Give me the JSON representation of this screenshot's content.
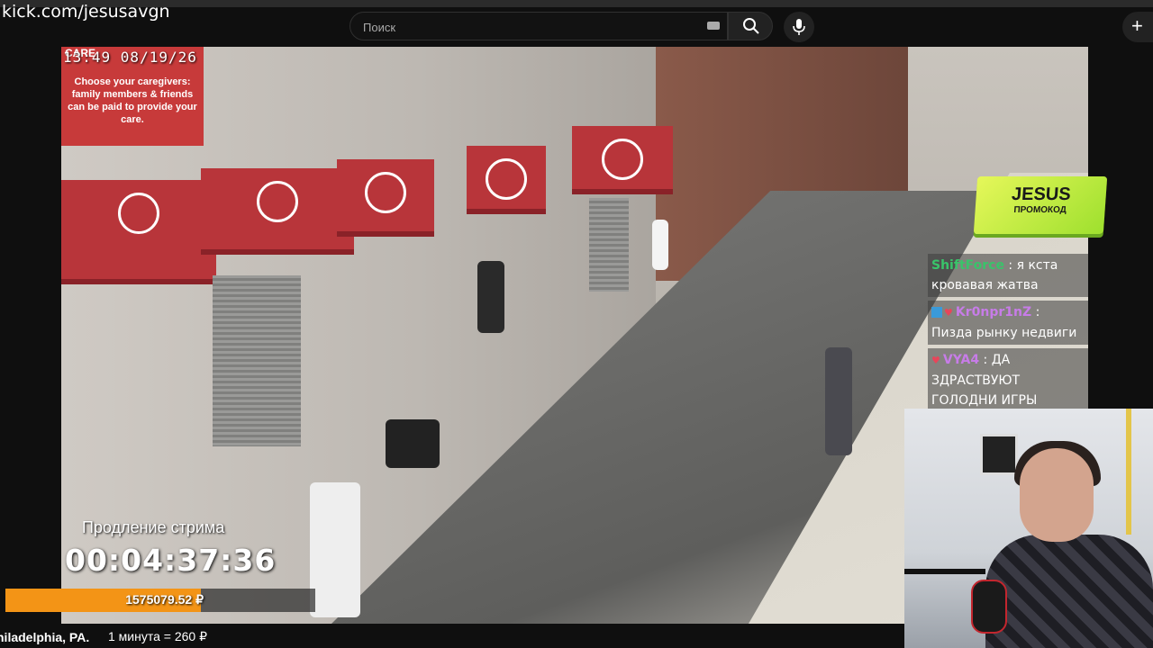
{
  "browser": {
    "url": "kick.com/jesusavgn"
  },
  "search": {
    "placeholder": "Поиск"
  },
  "icons": {
    "keyboard": "keyboard-icon",
    "search": "search-icon",
    "mic": "microphone-icon",
    "create": "plus-icon"
  },
  "create_label": "+",
  "video": {
    "cam_timestamp": "13:49 08/19/26",
    "sign_title": "CARE",
    "sign_text": "Choose your caregivers: family members & friends can be paid to provide your care."
  },
  "promo": {
    "title": "JESUS",
    "subtitle": "ПРОМОКОД"
  },
  "chat": {
    "messages": [
      {
        "user": "ShiftForce",
        "user_color": "#39c46a",
        "text": " : я кста кровавая жатва"
      },
      {
        "user": "Kr0npr1nZ",
        "user_color": "#c77ce8",
        "text": " : Пизда рынку недвиги"
      },
      {
        "user": "VYA4",
        "user_color": "#c77ce8",
        "text": " : ДА ЗДРАСТВУЮТ ГОЛОДНИ ИГРЫ"
      }
    ]
  },
  "stream": {
    "extension_label": "Продление стрима",
    "timer": "00:04:37:36",
    "amount": "1575079.52 ₽",
    "progress_fraction": 0.63,
    "rate": "1 минута = 260 ₽",
    "location": "hiladelphia, PA."
  },
  "colors": {
    "accent": "#f39416",
    "promo": "#c8f03c"
  }
}
